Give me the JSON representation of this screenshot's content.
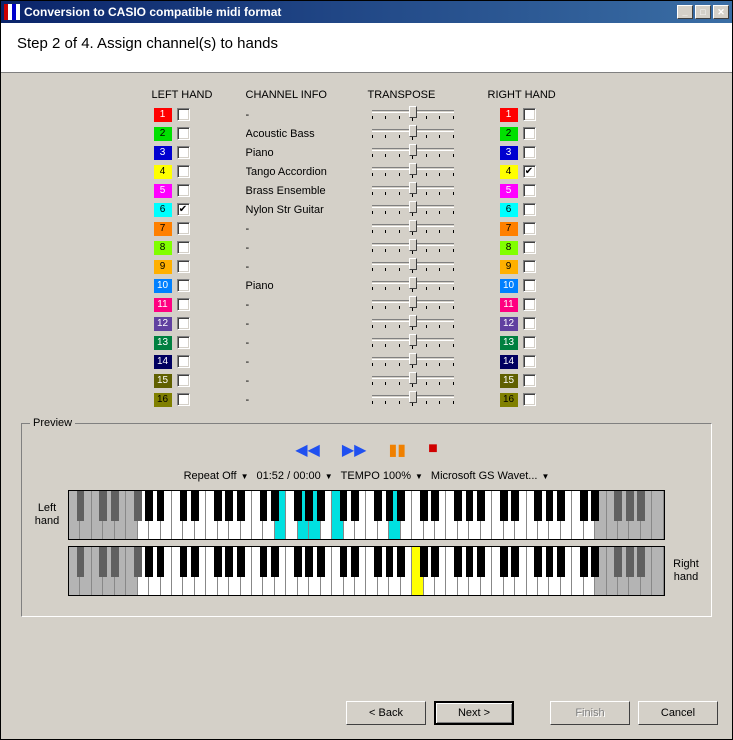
{
  "titlebar": {
    "title": "Conversion to CASIO compatible midi format"
  },
  "header": "Step 2 of 4. Assign channel(s) to hands",
  "columns": {
    "left": "LEFT HAND",
    "info": "CHANNEL INFO",
    "transpose": "TRANSPOSE",
    "right": "RIGHT HAND"
  },
  "channels": [
    {
      "n": "1",
      "color": "#ff0000",
      "fg": "#fff",
      "info": "-",
      "left": false,
      "right": false
    },
    {
      "n": "2",
      "color": "#00e000",
      "fg": "#000",
      "info": "Acoustic Bass",
      "left": false,
      "right": false
    },
    {
      "n": "3",
      "color": "#0000d0",
      "fg": "#fff",
      "info": "Piano",
      "left": false,
      "right": false
    },
    {
      "n": "4",
      "color": "#ffff00",
      "fg": "#000",
      "info": "Tango Accordion",
      "left": false,
      "right": true
    },
    {
      "n": "5",
      "color": "#ff00ff",
      "fg": "#fff",
      "info": "Brass Ensemble",
      "left": false,
      "right": false
    },
    {
      "n": "6",
      "color": "#00ffff",
      "fg": "#000",
      "info": "Nylon Str Guitar",
      "left": true,
      "right": false
    },
    {
      "n": "7",
      "color": "#ff8000",
      "fg": "#000",
      "info": "-",
      "left": false,
      "right": false
    },
    {
      "n": "8",
      "color": "#80ff00",
      "fg": "#000",
      "info": "-",
      "left": false,
      "right": false
    },
    {
      "n": "9",
      "color": "#ffb000",
      "fg": "#000",
      "info": "-",
      "left": false,
      "right": false
    },
    {
      "n": "10",
      "color": "#0080ff",
      "fg": "#fff",
      "info": "Piano",
      "left": false,
      "right": false
    },
    {
      "n": "11",
      "color": "#ff0080",
      "fg": "#fff",
      "info": "-",
      "left": false,
      "right": false
    },
    {
      "n": "12",
      "color": "#6040a0",
      "fg": "#fff",
      "info": "-",
      "left": false,
      "right": false
    },
    {
      "n": "13",
      "color": "#008040",
      "fg": "#fff",
      "info": "-",
      "left": false,
      "right": false
    },
    {
      "n": "14",
      "color": "#000060",
      "fg": "#fff",
      "info": "-",
      "left": false,
      "right": false
    },
    {
      "n": "15",
      "color": "#606000",
      "fg": "#fff",
      "info": "-",
      "left": false,
      "right": false
    },
    {
      "n": "16",
      "color": "#808000",
      "fg": "#000",
      "info": "-",
      "left": false,
      "right": false
    }
  ],
  "preview": {
    "label": "Preview",
    "repeat": "Repeat Off",
    "time": "01:52 / 00:00",
    "tempo": "TEMPO 100%",
    "device": "Microsoft GS Wavet...",
    "left_label": "Left hand",
    "right_label": "Right hand"
  },
  "footer": {
    "back": "< Back",
    "next": "Next >",
    "finish": "Finish",
    "cancel": "Cancel"
  }
}
